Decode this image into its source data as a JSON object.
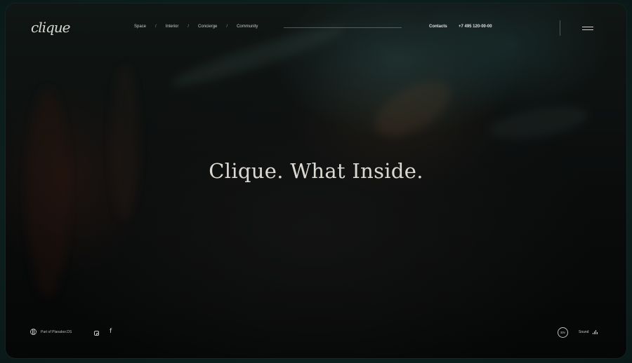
{
  "brand": {
    "logo_text": "clique"
  },
  "nav": {
    "items": [
      "Space",
      "Interior",
      "Concierge",
      "Community"
    ],
    "separator": "/"
  },
  "header": {
    "contacts_label": "Contacts",
    "phone": "+7 495 120-00-00"
  },
  "hero": {
    "headline": "Clique. What Inside."
  },
  "footer": {
    "part_of": "Part of Planabor.DS",
    "language": "EN",
    "sound_label": "Sound"
  },
  "icons": {
    "globe": "globe-icon",
    "instagram": "instagram-icon",
    "facebook": "facebook-icon",
    "menu": "hamburger-menu-icon",
    "sound": "sound-bars-icon"
  },
  "colors": {
    "outer_frame": "#0f2a27",
    "text_light": "#ddd9d2",
    "background_dark": "#0a0c0c"
  }
}
